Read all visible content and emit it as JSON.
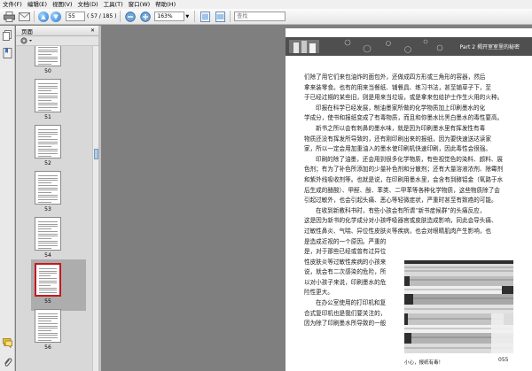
{
  "menubar": {
    "items": [
      "文件(F)",
      "编辑(E)",
      "视图(V)",
      "文档(D)",
      "工具(T)",
      "窗口(W)",
      "帮助(H)"
    ]
  },
  "toolbar": {
    "page_number": "55",
    "page_of": "( 57 / 185 )",
    "zoom": "163%",
    "search_placeholder": "查找"
  },
  "pages_panel": {
    "title": "页面",
    "thumbnails": [
      {
        "label": "50",
        "current": false
      },
      {
        "label": "51",
        "current": false
      },
      {
        "label": "52",
        "current": false
      },
      {
        "label": "53",
        "current": false
      },
      {
        "label": "54",
        "current": false
      },
      {
        "label": "55",
        "current": true
      },
      {
        "label": "56",
        "current": false
      }
    ]
  },
  "document": {
    "banner": "Part 2 揭开室室里的秘密",
    "lines": [
      "们除了用它们来包油炸的面包外，还做成四方形或三角形的容器，然后",
      "拿来装零食。也有的用来当餐纸、铺餐具、练习书法，甚至铺草子下，至",
      "于已经过期的某些旧，则是用来当垃圾，或是拿来包给护士作生火用的火种。",
      "印报在科学已经发展，制油墨家所做的化学物质加上印刷墨水的化",
      "学成分，使书和报纸变成了有毒物质，而且和你墨水比黑白墨水的毒性要高。",
      "新书之所以会有刺鼻的墨水味，就是因为印刷墨水里有挥发性有毒",
      "物质还没有挥发所导致的，还有刚印刷出来的报纸，因为要快速送达读家",
      "家，所以一定会用加重油入的墨水使印刷机快速印刷，因此毒性会很强。",
      "印刷的除了油墨，还会用到很多化学物质，有些视觉色的染料、颜料、展",
      "色剂；有为了补色所添加的少量补色剂和分散剂；还有大量溶液浓剂、除霉剂",
      "和紫外线吸收剂等。也就是说，在印刷用墨水里，会含有到酵铝金（氧路于水",
      "后生成的醋酸）、甲醛、酚、苯类、二甲苯等各种化学物质，这些物质除了会",
      "引起过敏外，也会引起头痛、恶心等轻微症状，严重时甚至有致癌的可能。",
      "在收到新教科书时，有些小孩会有所谓“新书症候群”的头痛反应，",
      "这是因为新书的化学成分对小孩呼吸器官或皮肤造成影响，同此会导头痛、",
      "过敏性鼻炎、气喘、异位性皮肤炎等疾病，也会对眼睛肌肉产生影响，也",
      "是造成近视的一个原因。严重的",
      "是，对于那些已经或曾有过异位",
      "性皮肤炎等过敏性疾病的小孩来",
      "说，就会有二次感染的危险，所",
      "以对小孩子来说，印刷墨水的危",
      "险性更大。",
      "在办公室使用的打印机和复",
      "合式复印机也是我们要关注的，",
      "因为除了印刷墨水所导致的一般"
    ],
    "caption": "小心，报纸有毒！",
    "page_number": "055"
  }
}
